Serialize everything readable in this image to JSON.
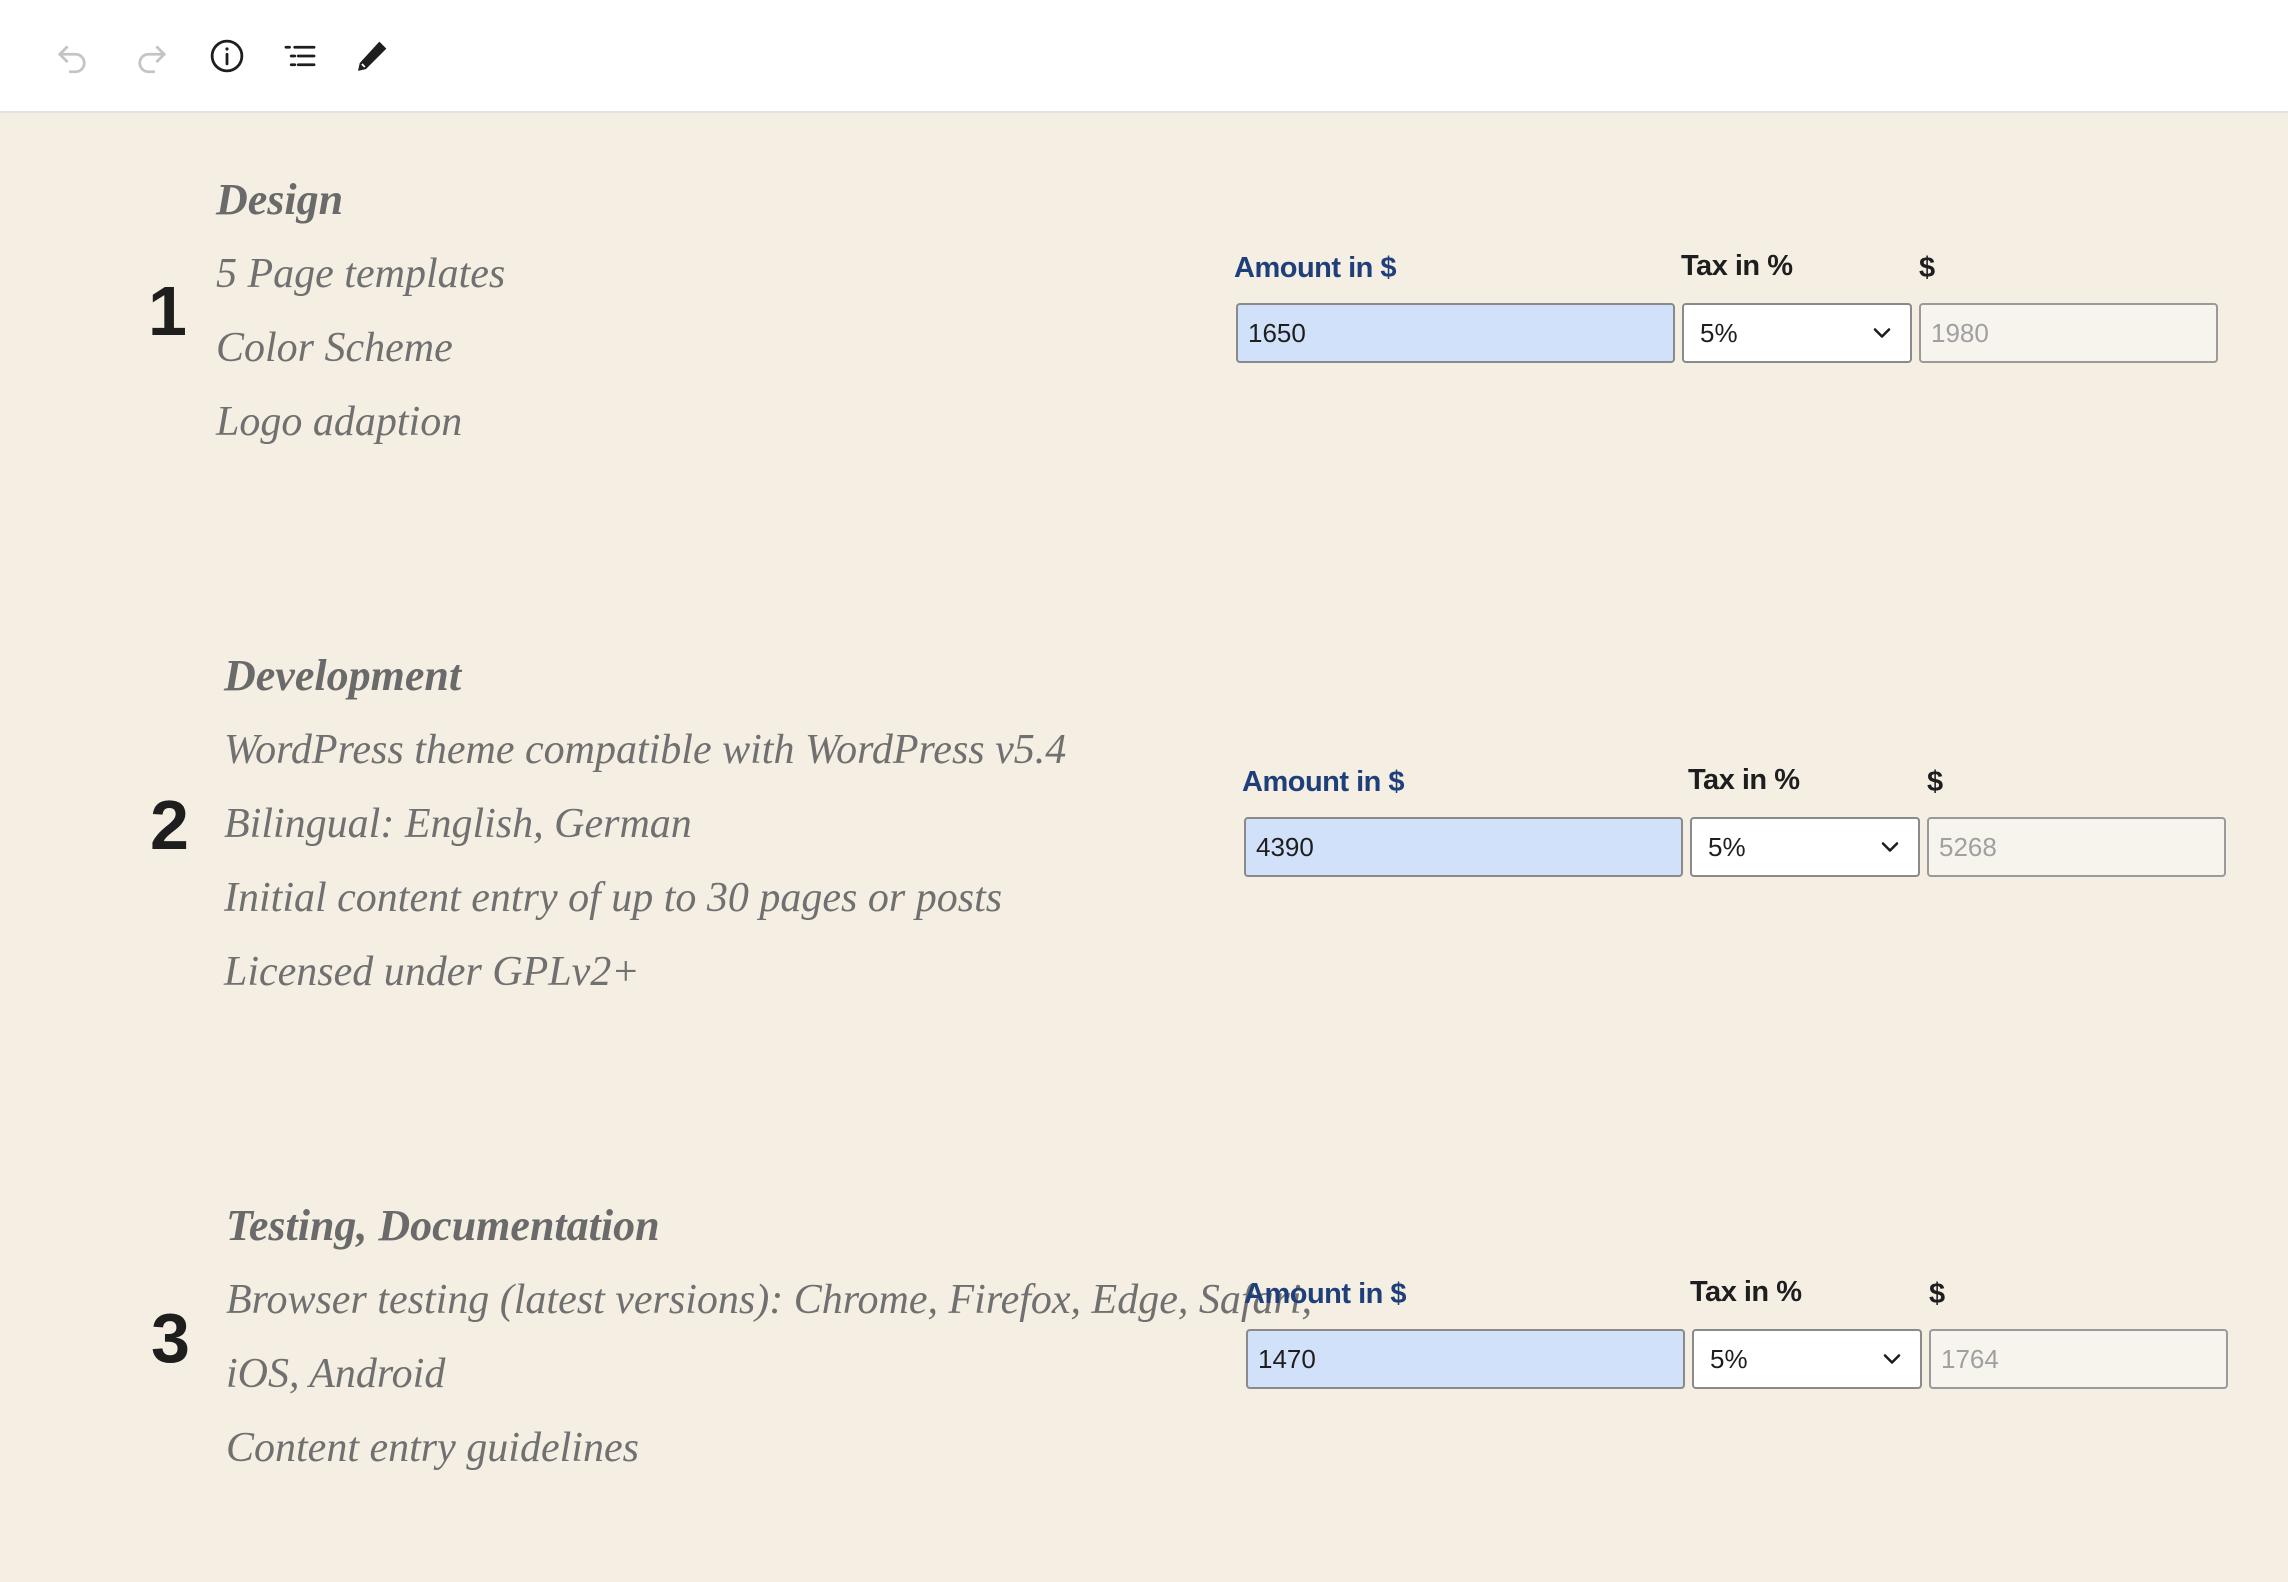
{
  "toolbar": {
    "buttons": [
      {
        "name": "undo-icon",
        "enabled": false
      },
      {
        "name": "redo-icon",
        "enabled": false
      },
      {
        "name": "info-icon",
        "enabled": true
      },
      {
        "name": "list-view-icon",
        "enabled": true
      },
      {
        "name": "edit-pencil-icon",
        "enabled": true
      }
    ]
  },
  "labels": {
    "amount": "Amount in $",
    "tax": "Tax in %",
    "total": "$"
  },
  "colors": {
    "background": "#f4eee3",
    "amount_label": "#1e3f7a",
    "amount_field": "#d2e1fa"
  },
  "items": [
    {
      "number": "1",
      "heading": "Design",
      "lines": [
        "5 Page templates",
        "Color Scheme",
        "Logo adaption"
      ],
      "amount": "1650",
      "tax": "5%",
      "total": "1980"
    },
    {
      "number": "2",
      "heading": "Development",
      "lines": [
        "WordPress theme compatible with WordPress v5.4",
        "Bilingual: English, German",
        "Initial content entry of up to 30 pages or posts",
        "Licensed under GPLv2+"
      ],
      "amount": "4390",
      "tax": "5%",
      "total": "5268"
    },
    {
      "number": "3",
      "heading": "Testing, Documentation",
      "lines": [
        "Browser testing (latest versions): Chrome, Firefox, Edge, Safari,",
        "iOS, Android",
        "Content entry guidelines"
      ],
      "amount": "1470",
      "tax": "5%",
      "total": "1764"
    }
  ]
}
